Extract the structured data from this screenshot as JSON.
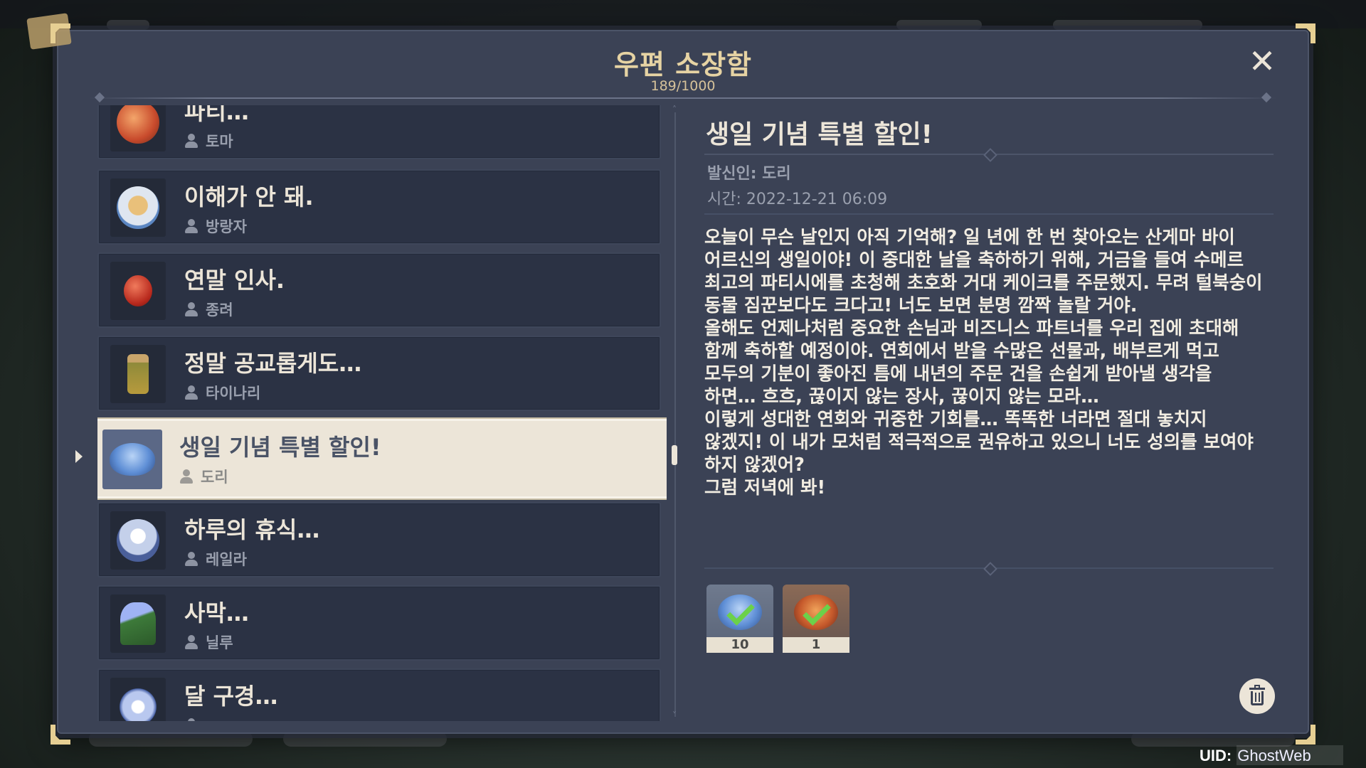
{
  "window": {
    "title": "우편 소장함",
    "count": "189/1000"
  },
  "mail_list": [
    {
      "subject": "파티…",
      "sender": "토마",
      "icon": "dish-icon",
      "color": "#d9643f"
    },
    {
      "subject": "이해가 안 돼.",
      "sender": "방랑자",
      "icon": "bowl-icon",
      "color": "#c9d6e6"
    },
    {
      "subject": "연말 인사.",
      "sender": "종려",
      "icon": "fruit-icon",
      "color": "#c8372a"
    },
    {
      "subject": "정말 공교롭게도…",
      "sender": "타이나리",
      "icon": "bottle-icon",
      "color": "#a88a3a"
    },
    {
      "subject": "생일 기념 특별 할인!",
      "sender": "도리",
      "icon": "mushroom-icon",
      "color": "#7aa6e0",
      "selected": true
    },
    {
      "subject": "하루의 휴식…",
      "sender": "레일라",
      "icon": "dessert-icon",
      "color": "#a7b6d8"
    },
    {
      "subject": "사막…",
      "sender": "닐루",
      "icon": "flower-icon",
      "color": "#8aa2e8"
    },
    {
      "subject": "달 구경…",
      "sender": "",
      "icon": "lily-icon",
      "color": "#c7d3f2"
    }
  ],
  "detail": {
    "title": "생일 기념 특별 할인!",
    "sender_line": "발신인: 도리",
    "time_line": "시간: 2022-12-21 06:09",
    "body_lines": [
      "오늘이 무슨 날인지 아직 기억해? 일 년에 한 번 찾아오는 산게마 바이",
      "어르신의 생일이야! 이 중대한 날을 축하하기 위해, 거금을 들여 수메르",
      "최고의 파티시에를 초청해 초호화 거대 케이크를 주문했지. 무려 털북숭이",
      "동물 짐꾼보다도 크다고! 너도 보면 분명 깜짝 놀랄 거야.",
      "올해도 언제나처럼 중요한 손님과 비즈니스 파트너를 우리 집에 초대해",
      "함께 축하할 예정이야. 연회에서 받을 수많은 선물과, 배부르게 먹고",
      "모두의 기분이 좋아진 틈에 내년의 주문 건을 손쉽게 받아낼 생각을",
      "하면… 흐흐, 끊이지 않는 장사, 끊이지 않는 모라…",
      "이렇게 성대한 연회와 귀중한 기회를… 똑똑한 너라면 절대 놓치지",
      "않겠지! 이 내가 모처럼 적극적으로 권유하고 있으니 너도 성의를 보여야",
      "하지 않겠어?",
      "그럼 저녁에 봐!"
    ],
    "attachments": [
      {
        "icon": "mushroom-icon",
        "qty": "10",
        "color": "#7aa6e0",
        "claimed": true
      },
      {
        "icon": "dish-icon",
        "qty": "1",
        "color": "#c65a2c",
        "claimed": true
      }
    ]
  },
  "footer": {
    "uid_label": "UID:",
    "uid_value": "GhostWeb"
  }
}
